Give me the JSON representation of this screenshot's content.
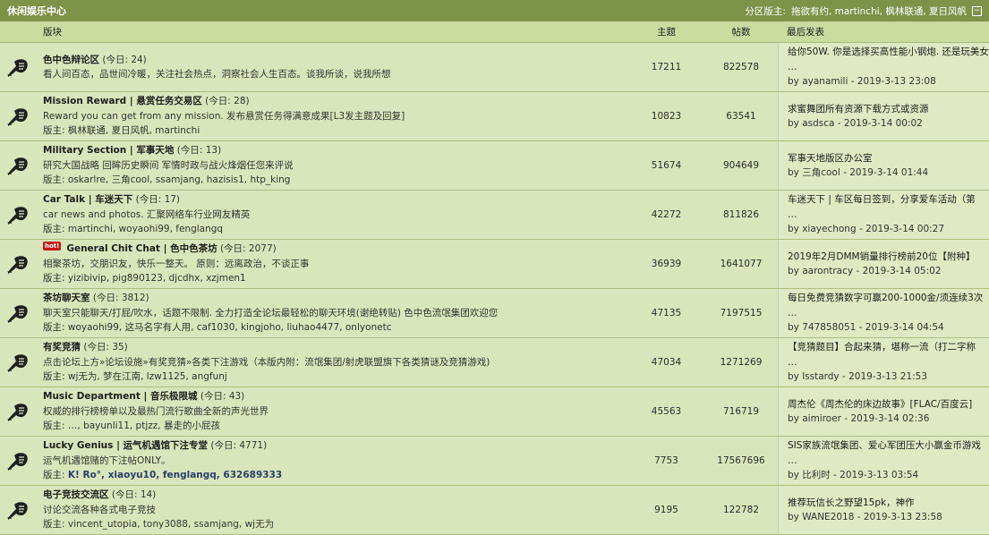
{
  "category": {
    "title": "休闲娱乐中心",
    "mods_label": "分区版主:",
    "mods": "拖欲有约, martinchi, 枫林联通, 夏日风帆",
    "collapse_icon": "minus-icon"
  },
  "columns": {
    "forum": "版块",
    "topics": "主题",
    "posts": "帖数",
    "last": "最后发表"
  },
  "forums": [
    {
      "name": "色中色辩论区",
      "today": "(今日: 24)",
      "desc": "看人间百态，品世间冷暖，关注社会热点，洞察社会人生百态。谈我所谈，说我所想",
      "mods_label": "",
      "mods": "",
      "mods_bold": false,
      "hot": false,
      "topics": "17211",
      "posts": "822578",
      "last_title": "给你50W. 你是选择买高性能小钢炮. 还是玩美女",
      "last_ellipsis": "…",
      "last_by": "by ayanamili - 2019-3-13 23:08"
    },
    {
      "name": "Mission Reward | 悬赏任务交易区",
      "today": "(今日: 28)",
      "desc": "Reward you can get from any mission. 发布悬赏任务得满意成果[L3发主题及回复]",
      "mods_label": "版主:",
      "mods": "枫林联通, 夏日风帆, martinchi",
      "mods_bold": false,
      "hot": false,
      "topics": "10823",
      "posts": "63541",
      "last_title": "求蜜舞团所有资源下载方式或资源",
      "last_ellipsis": "",
      "last_by": "by asdsca - 2019-3-14 00:02"
    },
    {
      "name": "Military Section | 军事天地",
      "today": "(今日: 13)",
      "desc": "研究大国战略 回眸历史瞬间 军情时政与战火烽烟任您来评说",
      "mods_label": "版主:",
      "mods": "oskarlre, 三角cool, ssamjang, hazisis1, htp_king",
      "mods_bold": false,
      "hot": false,
      "topics": "51674",
      "posts": "904649",
      "last_title": "军事天地版区办公室",
      "last_ellipsis": "",
      "last_by": "by 三角cool - 2019-3-14 01:44"
    },
    {
      "name": "Car Talk | 车迷天下",
      "today": "(今日: 17)",
      "desc": "car news and photos. 汇聚网络车行业网友精英",
      "mods_label": "版主:",
      "mods": "martinchi, woyaohi99, fenglangq",
      "mods_bold": false,
      "hot": false,
      "topics": "42272",
      "posts": "811826",
      "last_title": "车迷天下 | 车区每日签到，分享爱车活动（第",
      "last_ellipsis": "…",
      "last_by": "by xiayechong - 2019-3-14 00:27"
    },
    {
      "name": "General Chit Chat | 色中色茶坊",
      "today": "(今日: 2077)",
      "desc": "相聚茶坊，交朋识友，快乐一整天。 原则：远离政治，不谈正事",
      "mods_label": "版主:",
      "mods": "yizibivip, pig890123, djcdhx, xzjmen1",
      "mods_bold": false,
      "hot": true,
      "hot_label": "hot!",
      "topics": "36939",
      "posts": "1641077",
      "last_title": "2019年2月DMM销量排行榜前20位【附种】",
      "last_ellipsis": "",
      "last_by": "by aarontracy - 2019-3-14 05:02"
    },
    {
      "name": "茶坊聊天室",
      "today": "(今日: 3812)",
      "desc": "聊天室只能聊天/打屁/吹水，话题不限制. 全力打造全论坛最轻松的聊天环境(谢绝转贴) 色中色流氓集团欢迎您",
      "mods_label": "版主:",
      "mods": "woyaohi99, 这马名字有人用, caf1030, kingjoho, liuhao4477, onlyonetc",
      "mods_bold": false,
      "hot": false,
      "topics": "47135",
      "posts": "7197515",
      "last_title": "每日免费竞猜数字可赢200-1000金/须连续3次",
      "last_ellipsis": "…",
      "last_by": "by 747858051 - 2019-3-14 04:54"
    },
    {
      "name": "有奖竞猜",
      "today": "(今日: 35)",
      "desc": "点击论坛上方»论坛设施»有奖竞猜»各类下注游戏（本版内附：流氓集团/射虎联盟旗下各类猜谜及竞猜游戏)",
      "mods_label": "版主:",
      "mods": "wj无为, 梦在江南, lzw1125, angfunj",
      "mods_bold": false,
      "hot": false,
      "topics": "47034",
      "posts": "1271269",
      "last_title": "【竞猜题目】合起来猜，堪称一流（打二字称",
      "last_ellipsis": "…",
      "last_by": "by lsstardy - 2019-3-13 21:53"
    },
    {
      "name": "Music Department | 音乐极限城",
      "today": "(今日: 43)",
      "desc": "权威的排行榜榜单以及最热门流行歌曲全新的声光世界",
      "mods_label": "版主:",
      "mods": "…, bayunli11, ptjzz, 暴走的小屁孩",
      "mods_bold": false,
      "hot": false,
      "topics": "45563",
      "posts": "716719",
      "last_title": "周杰伦《周杰伦的床边故事》[FLAC/百度云]",
      "last_ellipsis": "",
      "last_by": "by aimiroer - 2019-3-14 02:36"
    },
    {
      "name": "Lucky Genius | 运气机遇馆下注专堂",
      "today": "(今日: 4771)",
      "desc": "运气机遇馆赌的下注帖ONLY。",
      "mods_label": "版主:",
      "mods": "K! Ro°, xiaoyu10, fenglangq, 632689333",
      "mods_bold": true,
      "hot": false,
      "topics": "7753",
      "posts": "17567696",
      "last_title": "SIS家族流氓集团、爱心军团压大小赢金币游戏",
      "last_ellipsis": "…",
      "last_by": "by 比利时 - 2019-3-13 03:54"
    },
    {
      "name": "电子竞技交流区",
      "today": "(今日: 14)",
      "desc": "讨论交流各种各式电子竞技",
      "mods_label": "版主:",
      "mods": "vincent_utopia, tony3088, ssamjang, wj无为",
      "mods_bold": false,
      "hot": false,
      "topics": "9195",
      "posts": "122782",
      "last_title": "推荐玩信长之野望15pk，神作",
      "last_ellipsis": "",
      "last_by": "by WANE2018 - 2019-3-13 23:58"
    }
  ],
  "colors": {
    "title_bg": "#7d9348",
    "row_bg": "#d9e6bb",
    "header_bg": "#cbda9f",
    "icon": "#1f1f1f"
  },
  "row_icon": "forum-status-icon"
}
